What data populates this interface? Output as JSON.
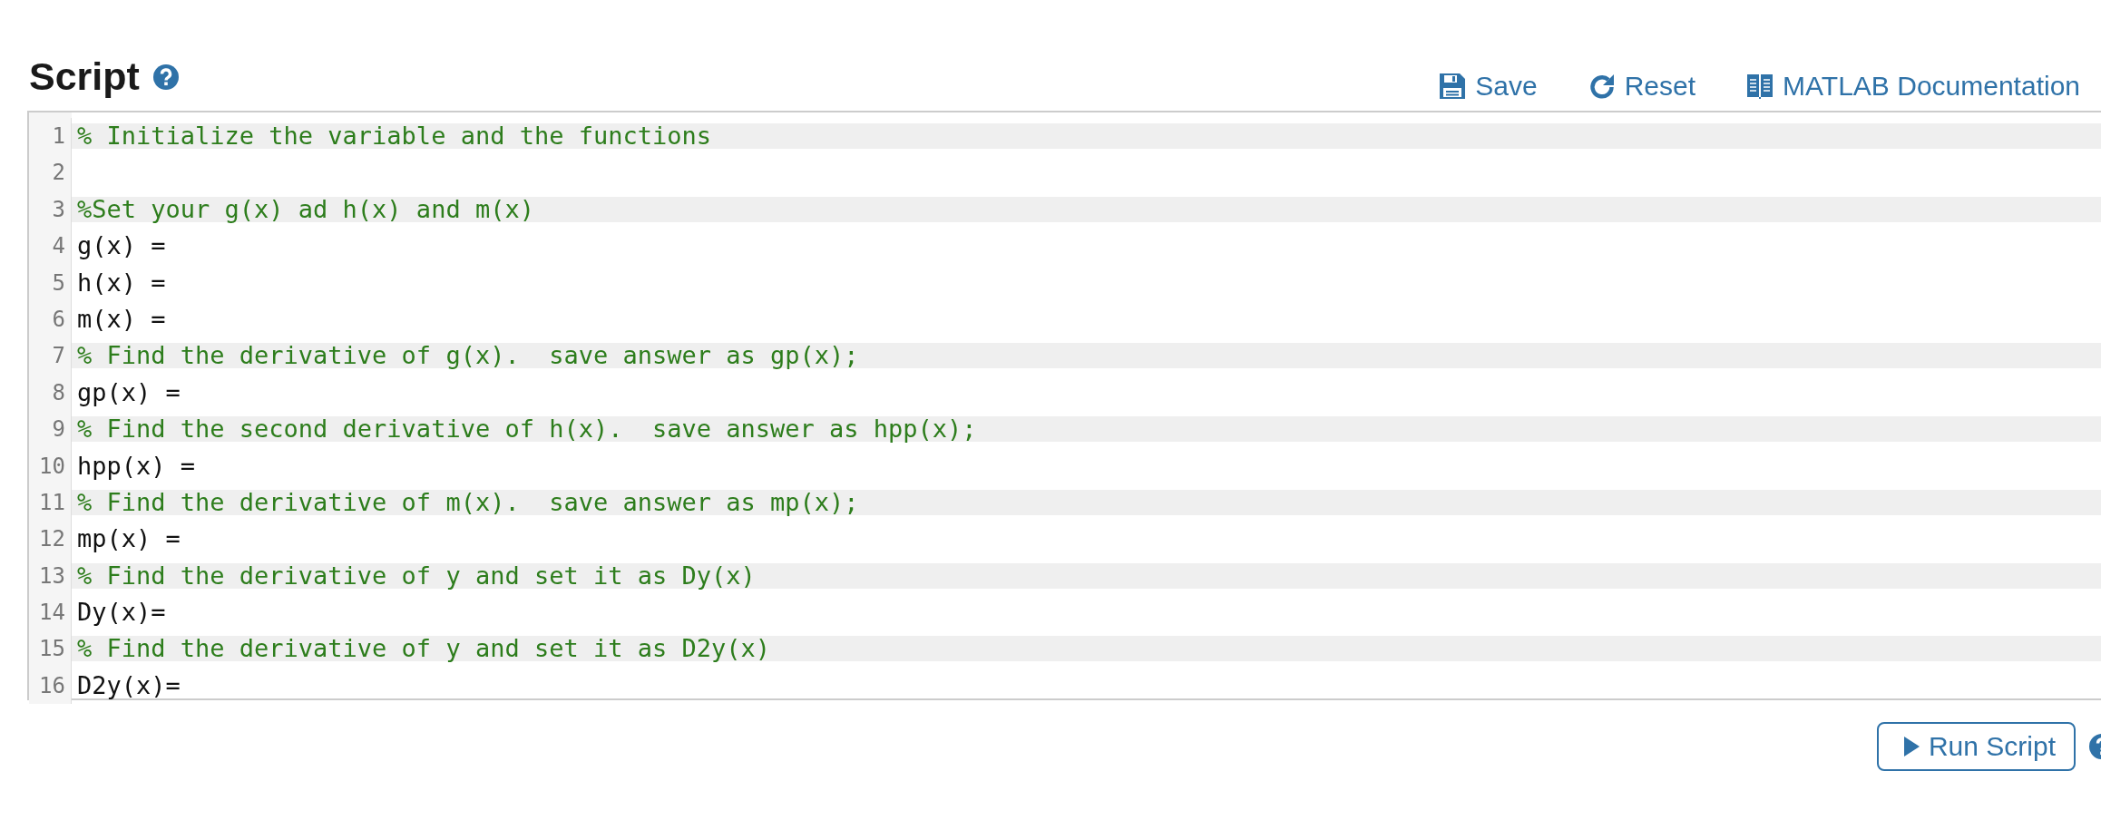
{
  "title": "Script",
  "toolbar": [
    {
      "kind": "save",
      "label": "Save"
    },
    {
      "kind": "reset",
      "label": "Reset"
    },
    {
      "kind": "docs",
      "label": "MATLAB Documentation"
    }
  ],
  "editor": {
    "lines": [
      {
        "number": "1",
        "kind": "comment",
        "text": "% Initialize the variable and the functions"
      },
      {
        "number": "2",
        "kind": "blank"
      },
      {
        "number": "3",
        "kind": "comment",
        "text": "%Set your g(x) ad h(x) and m(x)"
      },
      {
        "number": "4",
        "kind": "code",
        "text": "g(x) ="
      },
      {
        "number": "5",
        "kind": "code",
        "text": "h(x) ="
      },
      {
        "number": "6",
        "kind": "code",
        "text": "m(x) ="
      },
      {
        "number": "7",
        "kind": "comment",
        "text": "% Find the derivative of g(x).  save answer as gp(x);"
      },
      {
        "number": "8",
        "kind": "code",
        "text": "gp(x) ="
      },
      {
        "number": "9",
        "kind": "comment",
        "text": "% Find the second derivative of h(x).  save answer as hpp(x);"
      },
      {
        "number": "10",
        "kind": "code",
        "text": "hpp(x) ="
      },
      {
        "number": "11",
        "kind": "comment",
        "text": "% Find the derivative of m(x).  save answer as mp(x);"
      },
      {
        "number": "12",
        "kind": "code",
        "text": "mp(x) ="
      },
      {
        "number": "13",
        "kind": "comment",
        "text": "% Find the derivative of y and set it as Dy(x)"
      },
      {
        "number": "14",
        "kind": "code",
        "text": "Dy(x)="
      },
      {
        "number": "15",
        "kind": "comment",
        "text": "% Find the derivative of y and set it as D2y(x)"
      },
      {
        "number": "16",
        "kind": "code",
        "text": "D2y(x)="
      }
    ]
  },
  "run_button": {
    "label": "Run Script"
  }
}
